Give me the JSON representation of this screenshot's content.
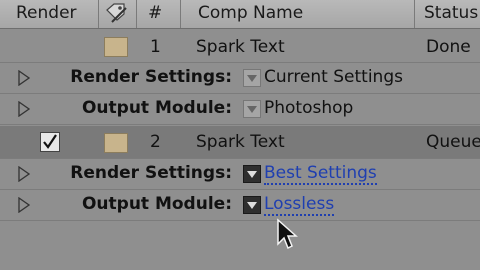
{
  "header": {
    "render": "Render",
    "tag_icon": "tag-pencil-icon",
    "number": "#",
    "comp_name": "Comp Name",
    "status": "Status"
  },
  "items": [
    {
      "number": "1",
      "name": "Spark Text",
      "status": "Done",
      "render_checked": false,
      "label_color": "#c8b48c",
      "render_settings_label": "Render Settings:",
      "render_settings_value": "Current Settings",
      "output_module_label": "Output Module:",
      "output_module_value": "Photoshop"
    },
    {
      "number": "2",
      "name": "Spark Text",
      "status": "Queue",
      "render_checked": true,
      "label_color": "#c8b48c",
      "render_settings_label": "Render Settings:",
      "render_settings_value": "Best Settings",
      "output_module_label": "Output Module:",
      "output_module_value": "Lossless"
    }
  ],
  "colors": {
    "header_bg": "#b0b0b0",
    "row_bg": "#8f8f8f",
    "selected_row_bg": "#7a7a7a",
    "link_blue": "#1f3fb0"
  },
  "cursor_icon": "mouse-pointer-icon"
}
